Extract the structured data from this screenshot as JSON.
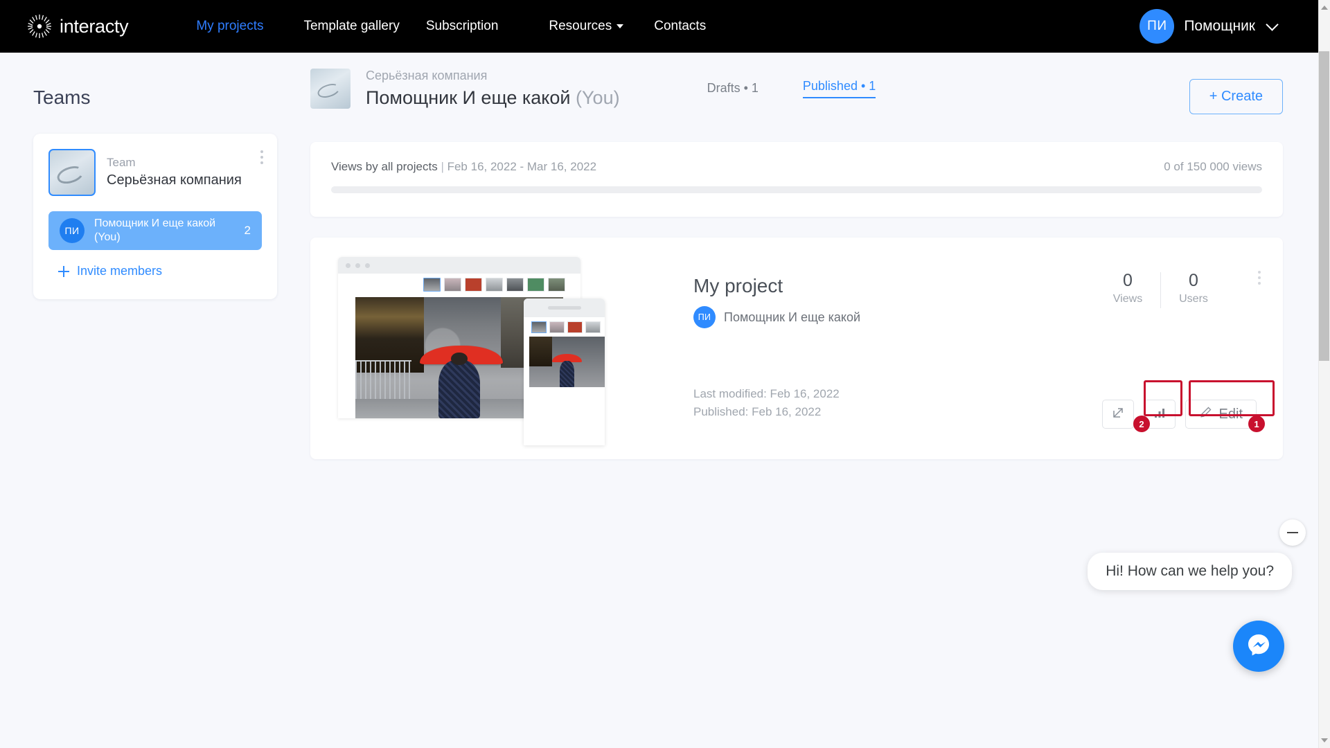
{
  "brand": {
    "name": "interacty",
    "logo_icon": "sunburst-icon",
    "accent": "#2f8bff",
    "nav_bg": "#000000"
  },
  "nav": {
    "items": [
      {
        "label": "My projects",
        "active": true
      },
      {
        "label": "Template gallery",
        "active": false
      },
      {
        "label": "Subscription",
        "active": false
      },
      {
        "label": "Resources",
        "active": false,
        "has_caret": true
      },
      {
        "label": "Contacts",
        "active": false
      }
    ],
    "user": {
      "initials": "ПИ",
      "name": "Помощник",
      "chevron": "chevron-down-icon"
    }
  },
  "sidebar": {
    "title": "Teams",
    "team": {
      "role_label": "Team",
      "name": "Серьёзная компания",
      "menu_icon": "more-vertical-icon"
    },
    "members": [
      {
        "initials": "ПИ",
        "name": "Помощник И еще какой (You)",
        "count": "2",
        "selected": true
      }
    ],
    "invite": {
      "label": "Invite members",
      "icon": "plus-icon"
    }
  },
  "main": {
    "header": {
      "team_name": "Серьёзная компания",
      "user_name": "Помощник И еще какой",
      "user_suffix": "(You)",
      "tabs": [
        {
          "label": "Drafts • 1",
          "active": false
        },
        {
          "label": "Published  • 1",
          "active": true
        }
      ],
      "create_button": "+ Create"
    },
    "views_panel": {
      "label": "Views by all projects",
      "separator": "|",
      "date_range": "Feb 16, 2022 - Mar 16, 2022",
      "count": "0 of 150 000 views",
      "progress_percent": 0
    },
    "project": {
      "title": "My project",
      "owner_initials": "ПИ",
      "owner_name": "Помощник И еще какой",
      "last_modified": "Last modified: Feb 16, 2022",
      "published": "Published: Feb 16, 2022",
      "stats": [
        {
          "value": "0",
          "label": "Views"
        },
        {
          "value": "0",
          "label": "Users"
        }
      ],
      "menu_icon": "more-vertical-icon",
      "actions": [
        {
          "name": "open-external",
          "icon": "external-link-icon",
          "label": ""
        },
        {
          "name": "statistics",
          "icon": "bar-chart-icon",
          "label": "",
          "annotation": "2"
        },
        {
          "name": "edit",
          "icon": "pencil-icon",
          "label": "Edit",
          "annotation": "1"
        }
      ],
      "annotation_color": "#c8102e"
    }
  },
  "chat": {
    "message": "Hi! How can we help you?",
    "minimize_icon": "minus-icon",
    "fab_icon": "messenger-icon",
    "fab_color": "#1b86fa"
  }
}
